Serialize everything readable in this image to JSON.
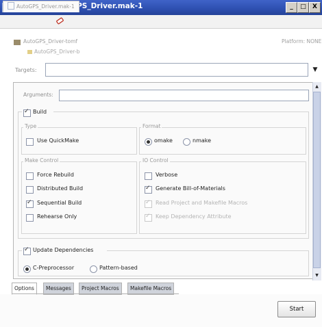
{
  "window": {
    "title": "Make for AutoGPS_Driver.mak-1",
    "minimize_symbol": "_",
    "maximize_symbol": "□",
    "close_symbol": "X"
  },
  "file_tab": {
    "label": "AutoGPS_Driver.mak-1"
  },
  "project": {
    "name": "AutoGPS_Driver-tomf",
    "sub": "AutoGPS_Driver-b",
    "platform": "Platform: NONE"
  },
  "targets": {
    "label": "Targets:",
    "value": ""
  },
  "arguments": {
    "label": "Arguments:",
    "value": ""
  },
  "build": {
    "label": "Build",
    "checked": true,
    "type": {
      "title": "Type",
      "use_quickmake": {
        "label": "Use QuickMake",
        "checked": false
      }
    },
    "format": {
      "title": "Format",
      "options": [
        {
          "label": "omake",
          "selected": true
        },
        {
          "label": "nmake",
          "selected": false
        }
      ]
    },
    "make_control": {
      "title": "Make Control",
      "items": [
        {
          "label": "Force Rebuild",
          "checked": false
        },
        {
          "label": "Distributed Build",
          "checked": false
        },
        {
          "label": "Sequential Build",
          "checked": true
        },
        {
          "label": "Rehearse Only",
          "checked": false
        }
      ]
    },
    "io_control": {
      "title": "IO Control",
      "items": [
        {
          "label": "Verbose",
          "checked": false,
          "disabled": false
        },
        {
          "label": "Generate Bill-of-Materials",
          "checked": true,
          "disabled": false
        },
        {
          "label": "Read Project and Makefile Macros",
          "checked": true,
          "disabled": true
        },
        {
          "label": "Keep Dependency Attribute",
          "checked": true,
          "disabled": true
        }
      ]
    }
  },
  "update_dependencies": {
    "label": "Update Dependencies",
    "checked": true,
    "options": [
      {
        "label": "C-Preprocessor",
        "selected": true
      },
      {
        "label": "Pattern-based",
        "selected": false
      }
    ]
  },
  "tabs": [
    "Options",
    "Messages",
    "Project Macros",
    "Makefile Macros"
  ],
  "start_button": "Start"
}
